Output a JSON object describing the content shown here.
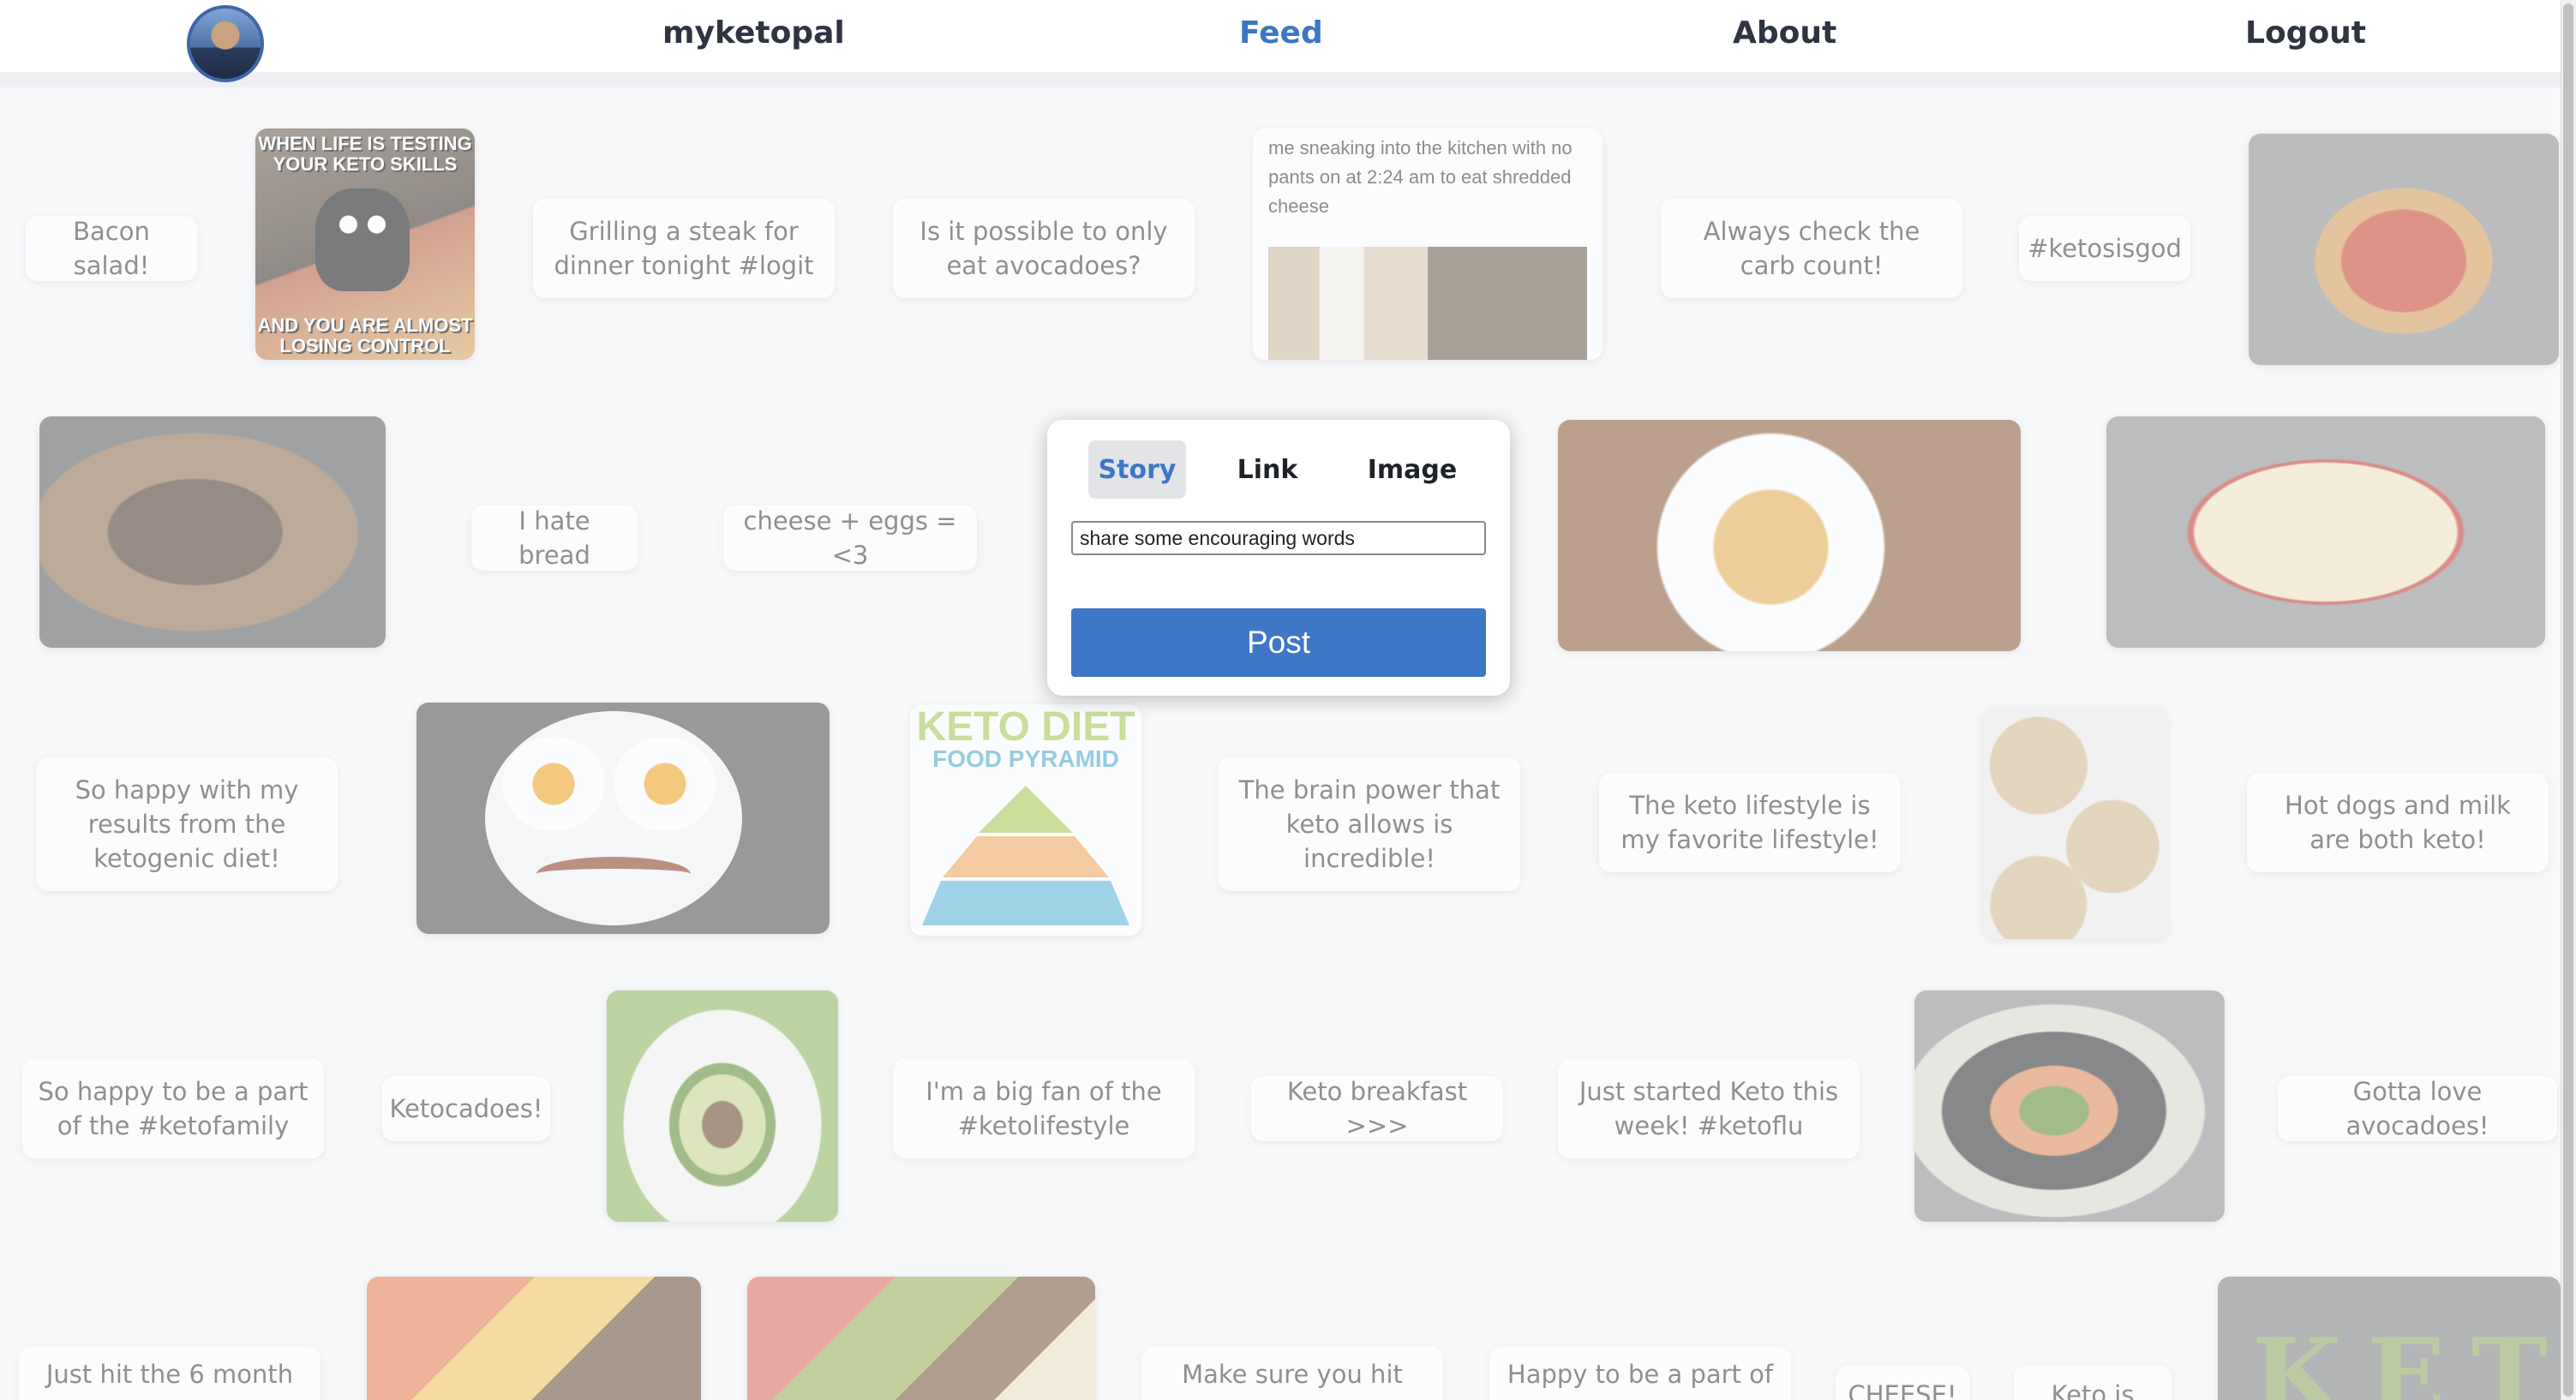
{
  "nav": {
    "brand": "myketopal",
    "feed": "Feed",
    "about": "About",
    "logout": "Logout"
  },
  "composer": {
    "tabs": [
      "Story",
      "Link",
      "Image"
    ],
    "active_tab": "Story",
    "input_value": "share some encouraging words",
    "post_label": "Post"
  },
  "feed": {
    "text_posts": [
      "Bacon salad!",
      "Grilling a steak for dinner tonight #logit",
      "Is it possible to only eat avocadoes?",
      "Always check the carb count!",
      "#ketosisgod",
      "I hate bread",
      "cheese + eggs = <3",
      "So happy with my results from the ketogenic diet!",
      "The brain power that keto allows is incredible!",
      "The keto lifestyle is my favorite lifestyle!",
      "Hot dogs and milk are both keto!",
      "So happy to be a part of the #ketofamily",
      "Ketocadoes!",
      "I'm a big fan of the #ketolifestyle",
      "Keto breakfast >>>",
      "Just started Keto this week! #ketoflu",
      "Gotta love avocadoes!",
      "Just hit the 6 month",
      "Make sure you hit your",
      "Happy to be a part of",
      "CHEESE!",
      "Keto is life!"
    ],
    "image_texts": {
      "meme_top": "WHEN LIFE IS TESTING YOUR KETO SKILLS",
      "meme_bottom": "AND YOU ARE ALMOST LOSING CONTROL",
      "tweet": "me sneaking into the kitchen with no pants on at 2:24 am to eat shredded cheese",
      "pyramid_title": "KETO DIET",
      "pyramid_subtitle": "FOOD PYRAMID",
      "keto_letters": "KETO"
    }
  },
  "colors": {
    "accent": "#3d77c4",
    "post_button": "#3f77c7",
    "nav_text": "#2e3440",
    "page_bg": "#f7f8fa"
  },
  "icons": {
    "avatar": "user-avatar"
  }
}
